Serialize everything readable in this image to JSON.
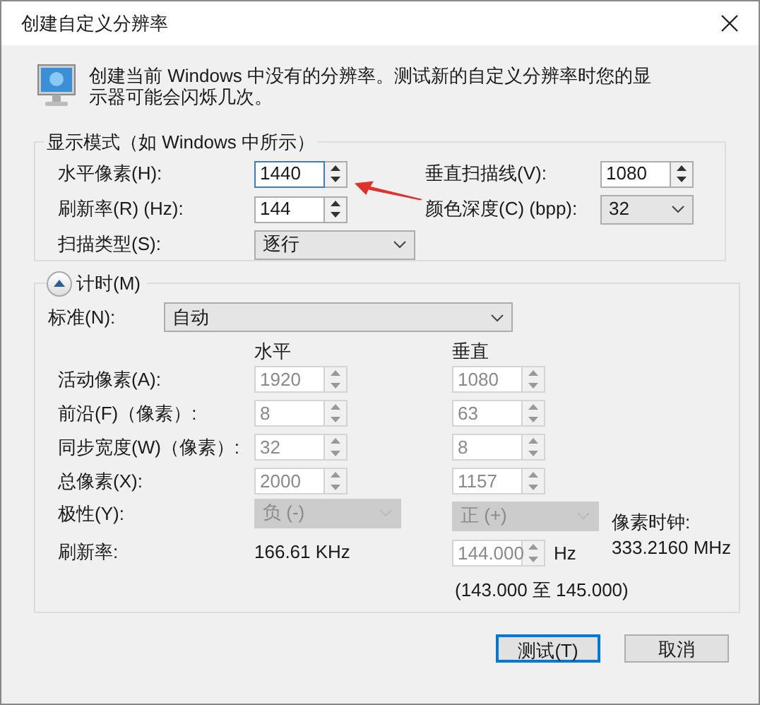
{
  "window": {
    "title": "创建自定义分辨率"
  },
  "description": "创建当前 Windows 中没有的分辨率。测试新的自定义分辨率时您的显示器可能会闪烁几次。",
  "display_mode": {
    "title": "显示模式（如 Windows 中所示）",
    "fields": [
      {
        "label": "水平像素(H):",
        "kind": "spinner",
        "value": "1440",
        "focused": true
      },
      {
        "label": "垂直扫描线(V):",
        "kind": "spinner",
        "value": "1080",
        "focused": false
      },
      {
        "label": "刷新率(R) (Hz):",
        "kind": "spinner",
        "value": "144",
        "focused": false
      },
      {
        "label": "颜色深度(C) (bpp):",
        "kind": "dropdown",
        "value": "32"
      },
      {
        "label": "扫描类型(S):",
        "kind": "dropdown",
        "value": "逐行"
      }
    ]
  },
  "annotation": {
    "kind": "arrow"
  },
  "timing": {
    "title": "计时(M)",
    "expanded": true,
    "standard": {
      "label": "标准(N):",
      "value": "自动"
    },
    "column_headers": [
      "水平",
      "垂直"
    ],
    "rows": [
      {
        "label": "活动像素(A):",
        "horizontal": "1920",
        "vertical": "1080",
        "disabled": true
      },
      {
        "label": "前沿(F)（像素）:",
        "horizontal": "8",
        "vertical": "63",
        "disabled": true
      },
      {
        "label": "同步宽度(W)（像素）:",
        "horizontal": "32",
        "vertical": "8",
        "disabled": true
      },
      {
        "label": "总像素(X):",
        "horizontal": "2000",
        "vertical": "1157",
        "disabled": true
      }
    ],
    "polarity": {
      "label": "极性(Y):",
      "horizontal": "负 (-)",
      "vertical": "正 (+)",
      "disabled": true
    },
    "pixel_clock": {
      "label": "像素时钟:",
      "value": "333.2160 MHz"
    },
    "refresh": {
      "label": "刷新率:",
      "horizontal": "166.61 KHz",
      "vertical": "144.000",
      "unit": "Hz",
      "range": "(143.000 至 145.000)",
      "disabled": true
    }
  },
  "buttons": [
    {
      "label": "测试(T)",
      "default": true
    },
    {
      "label": "取消",
      "default": false
    }
  ]
}
